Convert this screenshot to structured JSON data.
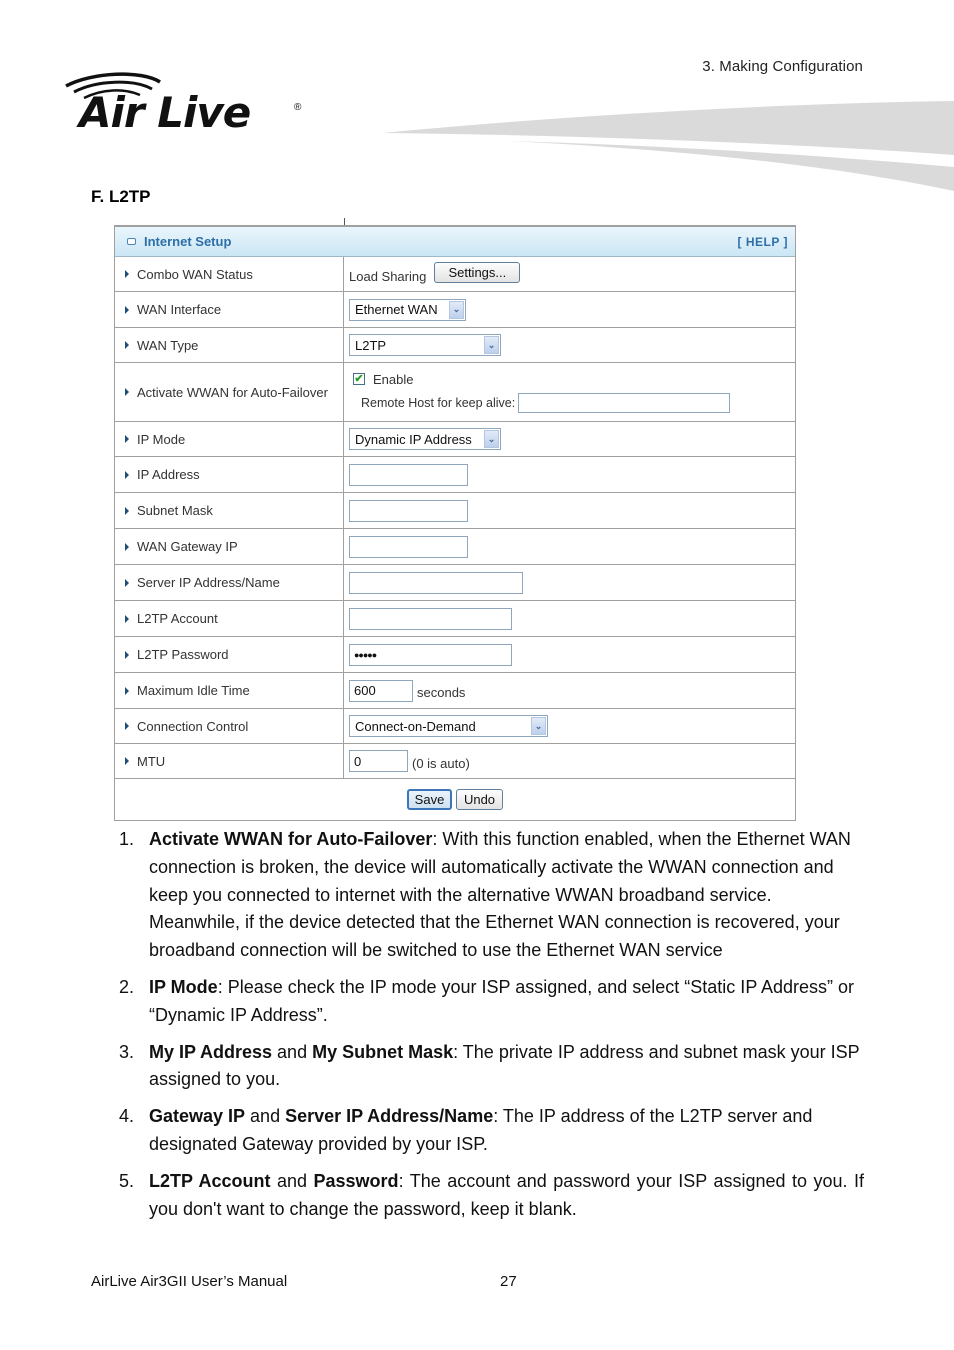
{
  "header": {
    "chapter": "3. Making Configuration",
    "logo_text": "Air Live",
    "logo_mark": "®"
  },
  "section_heading": "F. L2TP",
  "panel": {
    "title": "Internet Setup",
    "help_label": "[ HELP ]",
    "rows": {
      "combo_wan_status": {
        "label": "Combo WAN Status",
        "value": "Load Sharing",
        "button": "Settings..."
      },
      "wan_interface": {
        "label": "WAN Interface",
        "selected": "Ethernet WAN"
      },
      "wan_type": {
        "label": "WAN Type",
        "selected": "L2TP"
      },
      "activate_wwan": {
        "label": "Activate WWAN for Auto-Failover",
        "checkbox_label": "Enable",
        "checked": true,
        "check_glyph": "✔",
        "remote_host_label": "Remote Host for keep alive:",
        "remote_host_value": ""
      },
      "ip_mode": {
        "label": "IP Mode",
        "selected": "Dynamic IP Address"
      },
      "ip_address": {
        "label": "IP Address",
        "value": ""
      },
      "subnet_mask": {
        "label": "Subnet Mask",
        "value": ""
      },
      "wan_gateway_ip": {
        "label": "WAN Gateway IP",
        "value": ""
      },
      "server_ip": {
        "label": "Server IP Address/Name",
        "value": ""
      },
      "l2tp_account": {
        "label": "L2TP Account",
        "value": ""
      },
      "l2tp_password": {
        "label": "L2TP Password",
        "value": "●●●●●"
      },
      "max_idle_time": {
        "label": "Maximum Idle Time",
        "value": "600",
        "unit": "seconds"
      },
      "connection_control": {
        "label": "Connection Control",
        "selected": "Connect-on-Demand"
      },
      "mtu": {
        "label": "MTU",
        "value": "0",
        "hint": "(0 is auto)"
      }
    },
    "chevron_glyph": "⌄",
    "save_label": "Save",
    "undo_label": "Undo"
  },
  "notes": [
    {
      "num": "1.",
      "bold1": "Activate WWAN for Auto-Failover",
      "mid": "",
      "bold2": "",
      "text": ": With this function enabled, when the Ethernet WAN connection is broken, the device will automatically activate the WWAN connection and keep you connected to internet with the alternative WWAN broadband service. Meanwhile, if the device detected that the Ethernet WAN connection is recovered, your broadband connection will be switched to use the Ethernet WAN service"
    },
    {
      "num": "2.",
      "bold1": "IP Mode",
      "mid": "",
      "bold2": "",
      "text": ": Please check the IP mode your ISP assigned, and select “Static IP Address” or “Dynamic IP Address”."
    },
    {
      "num": "3.",
      "bold1": "My IP Address",
      "mid": " and ",
      "bold2": "My Subnet Mask",
      "text": ": The private IP address and subnet mask your ISP assigned to you."
    },
    {
      "num": "4.",
      "bold1": "Gateway IP",
      "mid": " and ",
      "bold2": "Server IP Address/Name",
      "text": ": The IP address of the L2TP server and designated Gateway provided by your ISP."
    },
    {
      "num": "5.",
      "bold1": "L2TP Account",
      "mid": " and ",
      "bold2": "Password",
      "text": ": The account and password your ISP assigned to you. If you don't want to change the password, keep it blank."
    }
  ],
  "footer": {
    "manual_title": "AirLive Air3GII User’s Manual",
    "page_number": "27"
  }
}
